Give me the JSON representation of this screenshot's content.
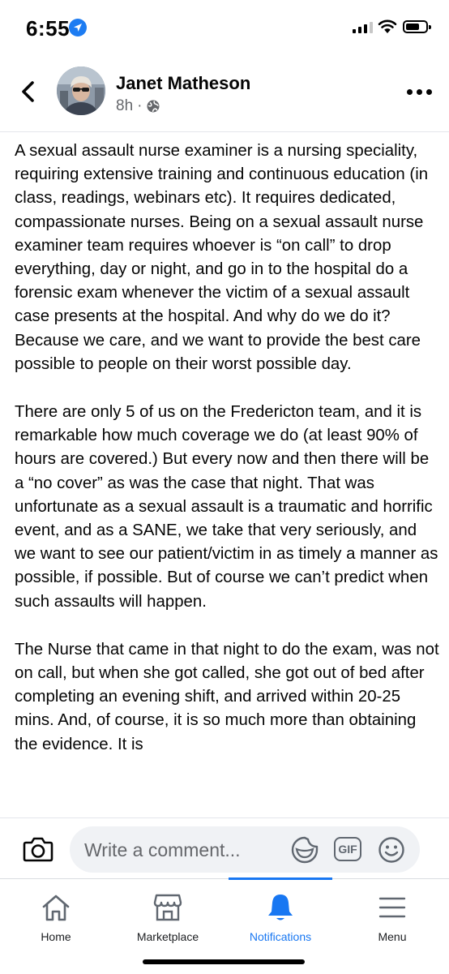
{
  "status_bar": {
    "time": "6:55"
  },
  "post": {
    "author": "Janet Matheson",
    "time_ago": "8h",
    "privacy_icon": "globe-icon",
    "paragraphs": [
      "A sexual assault nurse examiner is a nursing speciality, requiring extensive training and continuous education (in class, readings, webinars etc). It requires dedicated, compassionate nurses. Being on a sexual assault nurse examiner team requires whoever is “on call” to drop everything, day or night, and go in to the hospital do a forensic exam whenever the victim of a sexual assault case presents at the hospital. And why do we do it? Because we care, and we want to provide the best care possible to people on their worst possible day.",
      "There are only 5 of us on the Fredericton team, and it is remarkable how much coverage we do (at least 90% of hours are covered.) But every now and then there will be a “no cover” as was the case that night. That was unfortunate as a sexual assault is a traumatic and horrific event, and as a SANE, we take that very seriously, and we want to see our patient/victim in as timely a manner as possible, if possible. But of course we can’t predict when such assaults will happen.",
      "The Nurse that came in that night to do the exam, was not on call, but when she got called, she got out of bed after completing an evening shift, and arrived within 20-25 mins. And, of course, it is so much more than obtaining the evidence. It is"
    ]
  },
  "comment_bar": {
    "placeholder": "Write a comment..."
  },
  "tabs": [
    {
      "label": "Home",
      "icon": "home-icon",
      "active": false
    },
    {
      "label": "Marketplace",
      "icon": "marketplace-icon",
      "active": false
    },
    {
      "label": "Notifications",
      "icon": "bell-icon",
      "active": true
    },
    {
      "label": "Menu",
      "icon": "menu-icon",
      "active": false
    }
  ],
  "colors": {
    "accent": "#1877f2",
    "secondary_text": "#65676b",
    "location_badge": "#1d7cf2"
  }
}
